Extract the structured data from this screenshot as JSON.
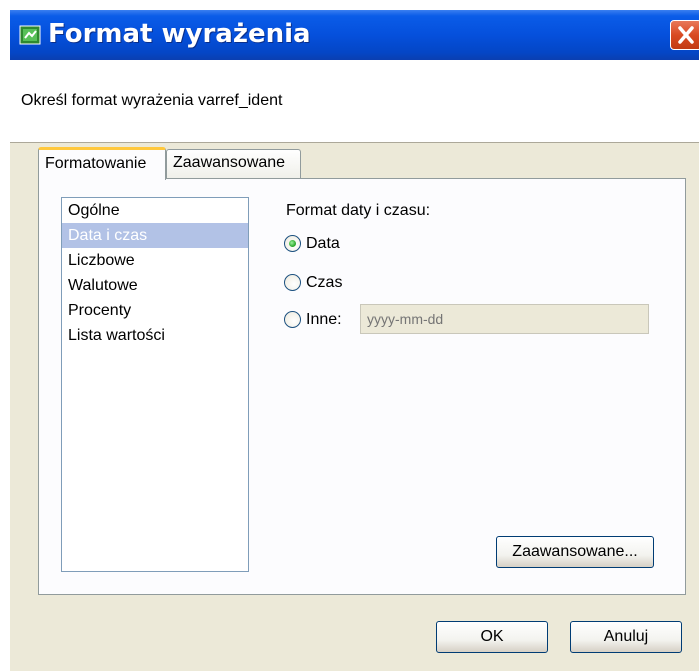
{
  "window": {
    "title": "Format wyrażenia",
    "description": "Określ format wyrażenia varref_ident"
  },
  "tabs": [
    {
      "label": "Formatowanie",
      "active": true
    },
    {
      "label": "Zaawansowane",
      "active": false
    }
  ],
  "category_list": {
    "items": [
      "Ogólne",
      "Data i czas",
      "Liczbowe",
      "Walutowe",
      "Procenty",
      "Lista wartości"
    ],
    "selected": "Data i czas"
  },
  "format_group": {
    "label": "Format daty i czasu:",
    "options": [
      {
        "label": "Data",
        "selected": true
      },
      {
        "label": "Czas",
        "selected": false
      },
      {
        "label": "Inne:",
        "selected": false
      }
    ],
    "other_placeholder": "yyyy-mm-dd"
  },
  "buttons": {
    "advanced": "Zaawansowane...",
    "ok": "OK",
    "cancel": "Anuluj"
  },
  "icons": {
    "app": "app-icon",
    "close": "close-icon",
    "radio_selected_color": "#21a121"
  }
}
